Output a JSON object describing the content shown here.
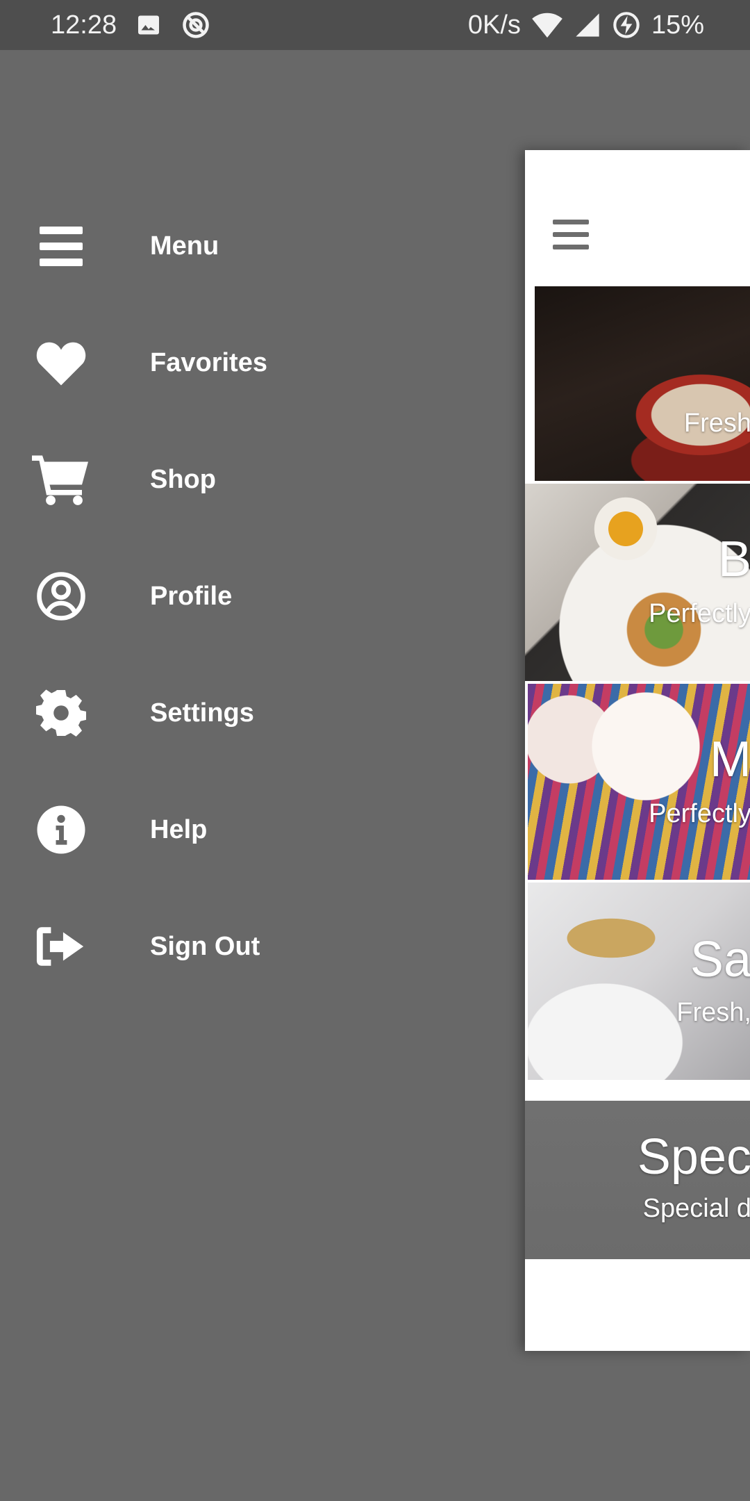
{
  "status_bar": {
    "time": "12:28",
    "network_speed": "0K/s",
    "battery": "15%",
    "icons": [
      "image-icon",
      "sync-icon",
      "wifi-icon",
      "signal-icon",
      "battery-charging-icon"
    ]
  },
  "drawer": {
    "items": [
      {
        "label": "Menu",
        "icon": "hamburger-menu-icon"
      },
      {
        "label": "Favorites",
        "icon": "heart-icon"
      },
      {
        "label": "Shop",
        "icon": "cart-icon"
      },
      {
        "label": "Profile",
        "icon": "user-circle-icon"
      },
      {
        "label": "Settings",
        "icon": "gear-icon"
      },
      {
        "label": "Help",
        "icon": "info-icon"
      },
      {
        "label": "Sign Out",
        "icon": "sign-out-icon"
      }
    ]
  },
  "app_panel": {
    "toolbar_icon": "hamburger-menu-icon",
    "cards": [
      {
        "title": "",
        "subtitle": "Fresh"
      },
      {
        "title": "B",
        "subtitle": "Perfectly"
      },
      {
        "title": "M",
        "subtitle": "Perfectly"
      },
      {
        "title": "Sa",
        "subtitle": "Fresh,"
      },
      {
        "title": "Spec",
        "subtitle": "Special d"
      }
    ]
  },
  "colors": {
    "scrim_background": "#686868",
    "status_bar": "#4e4e4e",
    "panel_background": "#ffffff",
    "menu_text": "#ffffff"
  }
}
